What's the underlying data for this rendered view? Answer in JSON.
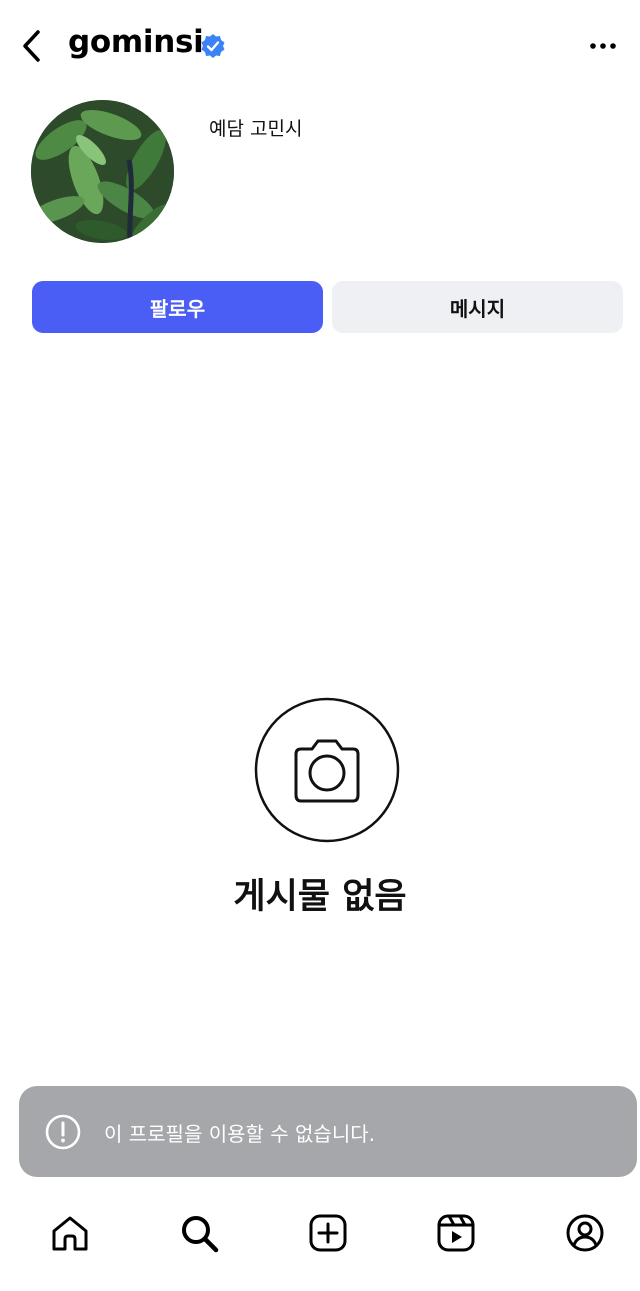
{
  "header": {
    "username": "gominsi",
    "back_icon": "chevron-left-icon",
    "verified_icon": "verified-badge-icon",
    "more_icon": "ellipsis-icon"
  },
  "profile": {
    "display_name": "예담 고민시",
    "avatar": "profile-photo-green-leaves"
  },
  "actions": {
    "follow_label": "팔로우",
    "message_label": "메시지"
  },
  "posts": {
    "empty_icon": "camera-icon",
    "empty_text": "게시물 없음"
  },
  "toast": {
    "icon": "exclamation-circle-icon",
    "text": "이 프로필을 이용할 수 없습니다."
  },
  "tabbar": {
    "items": [
      "home-icon",
      "search-icon",
      "create-post-icon",
      "reels-icon",
      "profile-icon"
    ]
  },
  "colors": {
    "accent": "#4a5df5",
    "verified": "#3b82f6",
    "secondary_button": "#eef0f4",
    "toast_bg": "#a6a7aa"
  }
}
